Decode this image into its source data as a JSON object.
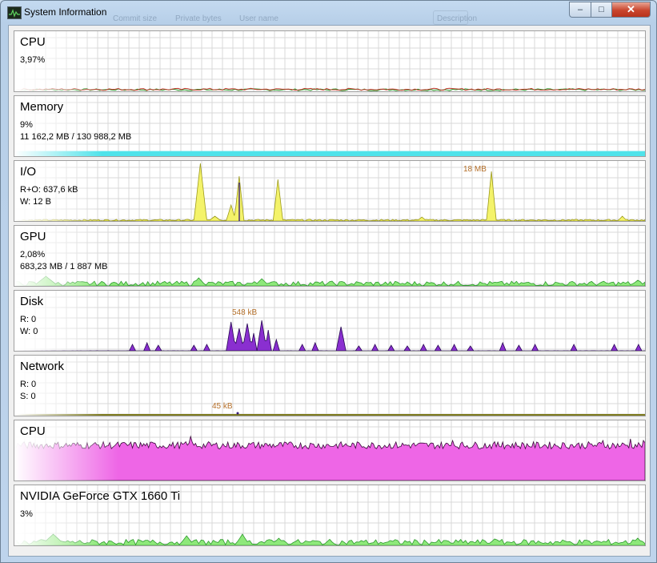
{
  "window": {
    "title": "System Information",
    "ghost_text": [
      "Commit size",
      "Private bytes",
      "User name",
      "Description"
    ],
    "controls": {
      "minimize": "–",
      "maximize": "□",
      "close": "✕"
    }
  },
  "panels": [
    {
      "id": "cpu",
      "title": "CPU",
      "lines": [
        "3,97%"
      ]
    },
    {
      "id": "memory",
      "title": "Memory",
      "lines": [
        "9%",
        "11 162,2 MB / 130 988,2 MB"
      ],
      "fill_fraction": 0.085
    },
    {
      "id": "io",
      "title": "I/O",
      "lines": [
        "R+O: 637,6 kB",
        "W: 12 B"
      ],
      "peak_label": "18 MB"
    },
    {
      "id": "gpu",
      "title": "GPU",
      "lines": [
        "2,08%",
        "683,23 MB / 1 887 MB"
      ]
    },
    {
      "id": "disk",
      "title": "Disk",
      "lines": [
        "R: 0",
        "W: 0"
      ],
      "peak_label": "548 kB"
    },
    {
      "id": "network",
      "title": "Network",
      "lines": [
        "R: 0",
        "S: 0"
      ],
      "peak_label": "45 kB"
    },
    {
      "id": "cpu2",
      "title": "CPU",
      "lines": []
    },
    {
      "id": "gpu-device",
      "title": "NVIDIA GeForce GTX 1660 Ti",
      "lines": [
        "3%"
      ]
    }
  ],
  "colors": {
    "grid": "#d8d8d8",
    "cpu_line_red": "#c0392b",
    "cpu_line_green": "#2e9a2e",
    "memory_fill": "#4fe3ea",
    "io_fill": "#f4f36a",
    "io_line": "#9c9a1a",
    "io_spike_purple": "#3a1f7a",
    "gpu_fill": "#8ee87a",
    "disk_fill": "#8a2fd0",
    "disk_line": "#2a0a55",
    "cpu2_fill": "#ee66e6",
    "cpu2_line": "#3a0a3a",
    "annotation": "#b5702a"
  }
}
